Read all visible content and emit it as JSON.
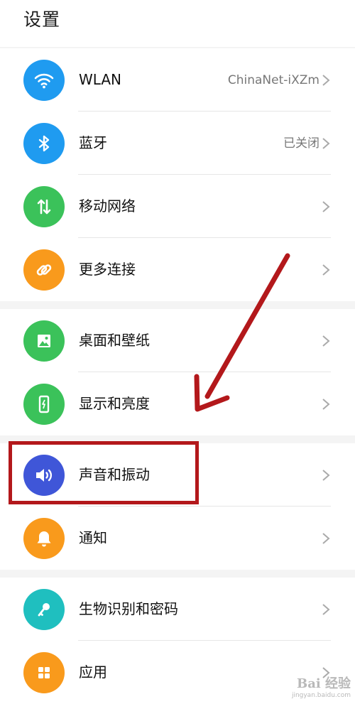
{
  "header": {
    "title": "设置"
  },
  "groups": [
    {
      "items": [
        {
          "label": "WLAN",
          "value": "ChinaNet-iXZm",
          "icon": "wifi-icon",
          "color": "#1f9bf0"
        },
        {
          "label": "蓝牙",
          "value": "已关闭",
          "icon": "bluetooth-icon",
          "color": "#1f9bf0"
        },
        {
          "label": "移动网络",
          "value": "",
          "icon": "mobile-data-icon",
          "color": "#3bc25a"
        },
        {
          "label": "更多连接",
          "value": "",
          "icon": "link-icon",
          "color": "#f99a1c"
        }
      ]
    },
    {
      "items": [
        {
          "label": "桌面和壁纸",
          "value": "",
          "icon": "wallpaper-icon",
          "color": "#3bc25a"
        },
        {
          "label": "显示和亮度",
          "value": "",
          "icon": "display-icon",
          "color": "#3bc25a"
        }
      ]
    },
    {
      "items": [
        {
          "label": "声音和振动",
          "value": "",
          "icon": "volume-icon",
          "color": "#3f56d8"
        },
        {
          "label": "通知",
          "value": "",
          "icon": "bell-icon",
          "color": "#f99a1c"
        }
      ]
    },
    {
      "items": [
        {
          "label": "生物识别和密码",
          "value": "",
          "icon": "key-icon",
          "color": "#1fbfbf"
        },
        {
          "label": "应用",
          "value": "",
          "icon": "apps-icon",
          "color": "#f99a1c"
        }
      ]
    }
  ],
  "annotation": {
    "color": "#b3181b"
  },
  "watermark": {
    "brand": "Bai 经验",
    "url": "jingyan.baidu.com"
  }
}
